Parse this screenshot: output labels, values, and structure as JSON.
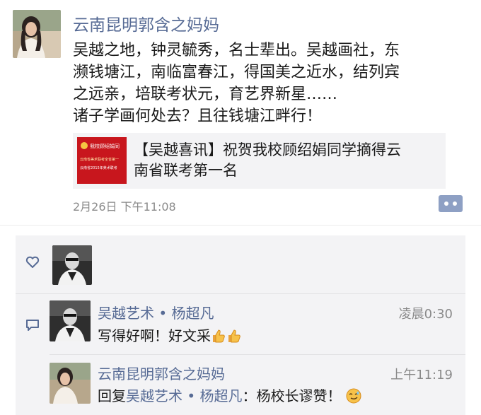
{
  "post": {
    "author": "云南昆明郭含之妈妈",
    "text_lines": [
      "吴越之地，钟灵毓秀，名士辈出。吴越画社，东",
      "濒钱塘江，南临富春江，得国美之近水，结列宾",
      "之远亲，培联考状元，育艺界新星……",
      "诸子学画何处去？且往钱塘江畔行！"
    ],
    "link": {
      "title_lines": [
        "【吴越喜讯】祝贺我校顾绍娟同学摘得云",
        "南省联考第一名"
      ],
      "thumb_text": [
        "我校顾绍娟同",
        "云南省美术联考全省第一",
        "云南省2015年美术联考"
      ]
    },
    "time": "2月26日 下午11:08"
  },
  "interactions": {
    "like_icon": "heart-outline-icon",
    "comment_icon": "speech-bubble-icon",
    "comments": [
      {
        "author": "吴越艺术 • 杨超凡",
        "time": "凌晨0:30",
        "text": "写得好啊！好文采",
        "emoji": [
          "thumbs-up",
          "thumbs-up"
        ]
      },
      {
        "author": "云南昆明郭含之妈妈",
        "time": "上午11:19",
        "reply_prefix": "回复",
        "reply_to": "吴越艺术 • 杨超凡",
        "text": "：杨校长谬赞！",
        "emoji": [
          "smirk-face"
        ]
      }
    ]
  },
  "colors": {
    "name_blue": "#576b95",
    "comment_bg": "#f3f3f5",
    "thumb_red": "#c8161d"
  }
}
